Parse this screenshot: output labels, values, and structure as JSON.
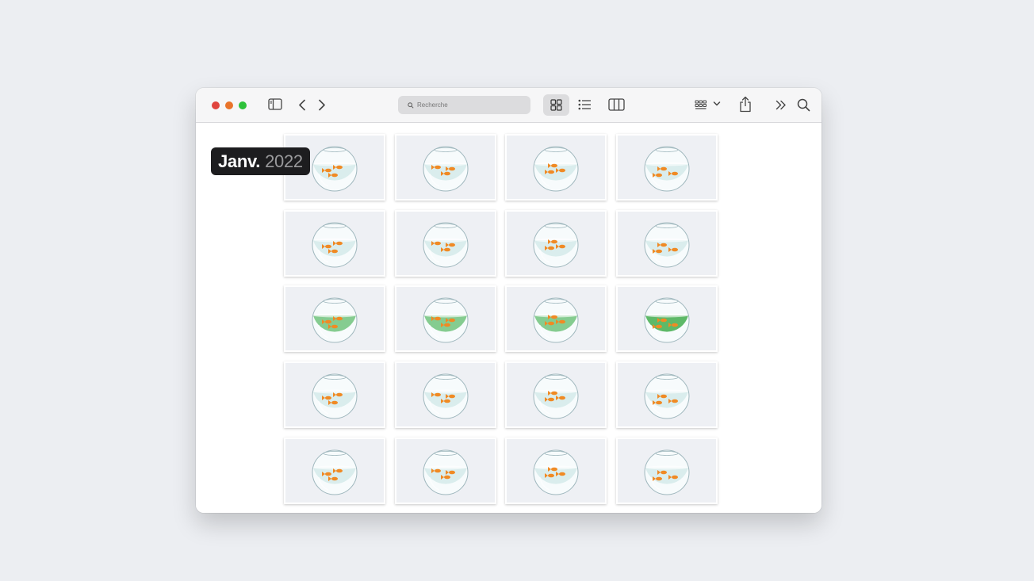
{
  "toolbar": {
    "search_placeholder": "Recherche",
    "icons": [
      "sidebar-icon",
      "back-icon",
      "forward-icon",
      "search-icon",
      "grid-view-icon",
      "list-view-icon",
      "column-view-icon",
      "group-icon",
      "share-icon",
      "more-icon",
      "search-icon"
    ]
  },
  "date_badge": {
    "month": "Janv.",
    "year": "2022"
  },
  "gallery": {
    "columns": 4,
    "rows": [
      {
        "water": "clear"
      },
      {
        "water": "clear"
      },
      {
        "water": "green"
      },
      {
        "water": "clear"
      },
      {
        "water": "clear"
      }
    ],
    "colors": {
      "clear_water": "#d8ecec",
      "green_water": "#7ec98a",
      "deep_green": "#55b560",
      "fish": "#f08a24"
    }
  }
}
